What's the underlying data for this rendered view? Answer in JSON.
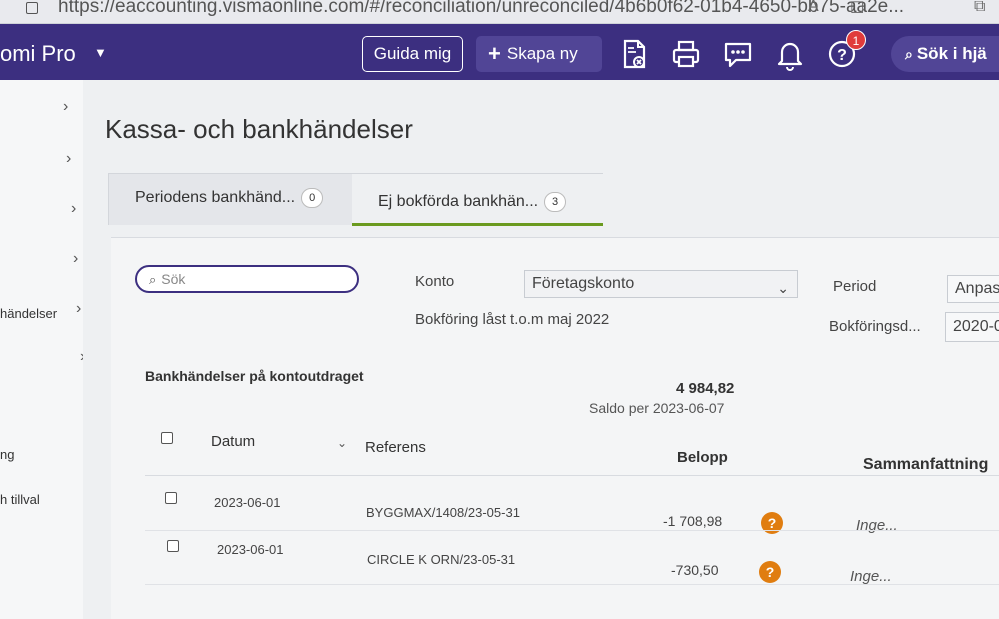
{
  "browser": {
    "url": "https://eaccounting.vismaonline.com/#/reconciliation/unreconciled/4b6b0f62-01b4-4650-bb75-aa2e..."
  },
  "nav": {
    "brand": "omi Pro",
    "guida_label": "Guida mig",
    "skapa_label": "Skapa ny",
    "help_badge": "1",
    "search_label": "Sök i hjä"
  },
  "sidebar": {
    "items": [
      {
        "label": ""
      },
      {
        "label": ""
      },
      {
        "label": ""
      },
      {
        "label": ""
      },
      {
        "label": "händelser"
      },
      {
        "label": ""
      },
      {
        "label": ""
      },
      {
        "label": "ng"
      },
      {
        "label": "h tillval"
      }
    ]
  },
  "page": {
    "title": "Kassa- och bankhändelser"
  },
  "tabs": [
    {
      "label": "Periodens bankhänd...",
      "count": "0"
    },
    {
      "label": "Ej bokförda bankhän...",
      "count": "3"
    }
  ],
  "filters": {
    "search_placeholder": "Sök",
    "konto_label": "Konto",
    "konto_value": "Företagskonto",
    "lock_info": "Bokföring låst t.o.m maj 2022",
    "period_label": "Period",
    "period_value": "Anpas",
    "bokforingsdatum_label": "Bokföringsd...",
    "bokforingsdatum_value": "2020-0"
  },
  "statement": {
    "title": "Bankhändelser på kontoutdraget",
    "balance": "4 984,82",
    "balance_label": "Saldo per 2023-06-07"
  },
  "table": {
    "columns": {
      "datum": "Datum",
      "referens": "Referens",
      "belopp": "Belopp",
      "sammanfattning": "Sammanfattning"
    },
    "rows": [
      {
        "datum": "2023-06-01",
        "referens": "BYGGMAX/1408/23-05-31",
        "belopp": "-1 708,98",
        "sammanfattning": "Inge..."
      },
      {
        "datum": "2023-06-01",
        "referens": "CIRCLE K ORN/23-05-31",
        "belopp": "-730,50",
        "sammanfattning": "Inge..."
      }
    ]
  },
  "colors": {
    "nav_bg": "#3c2f80",
    "tab_active_underline": "#6a9a1f",
    "warning": "#e07d10",
    "badge": "#e03b3b"
  }
}
